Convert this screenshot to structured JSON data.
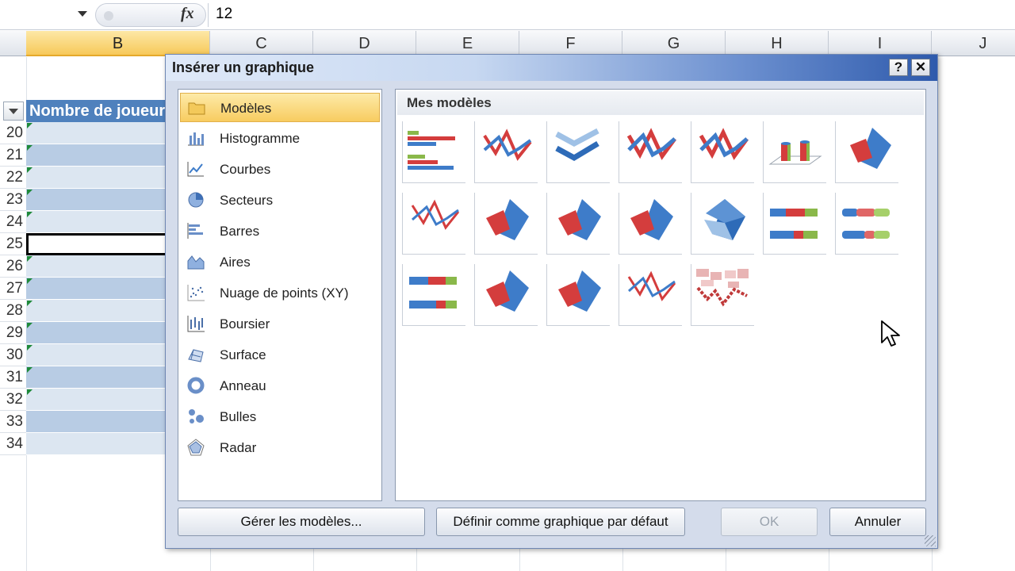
{
  "formula_bar": {
    "fx_label": "fx",
    "value": "12"
  },
  "columns": [
    "B",
    "C",
    "D",
    "E",
    "F",
    "G",
    "H",
    "I",
    "J"
  ],
  "sheet": {
    "table_header": "Nombre de joueurs",
    "rows": [
      "20",
      "21",
      "22",
      "23",
      "24",
      "25",
      "26",
      "27",
      "28",
      "29",
      "30",
      "31",
      "32",
      "33",
      "34"
    ]
  },
  "dialog": {
    "title": "Insérer un graphique",
    "help_label": "?",
    "close_label": "✕",
    "categories": [
      {
        "label": "Modèles",
        "icon": "folder-icon"
      },
      {
        "label": "Histogramme",
        "icon": "column-chart-icon"
      },
      {
        "label": "Courbes",
        "icon": "line-chart-icon"
      },
      {
        "label": "Secteurs",
        "icon": "pie-chart-icon"
      },
      {
        "label": "Barres",
        "icon": "bar-chart-icon"
      },
      {
        "label": "Aires",
        "icon": "area-chart-icon"
      },
      {
        "label": "Nuage de points (XY)",
        "icon": "scatter-chart-icon"
      },
      {
        "label": "Boursier",
        "icon": "stock-chart-icon"
      },
      {
        "label": "Surface",
        "icon": "surface-chart-icon"
      },
      {
        "label": "Anneau",
        "icon": "doughnut-chart-icon"
      },
      {
        "label": "Bulles",
        "icon": "bubble-chart-icon"
      },
      {
        "label": "Radar",
        "icon": "radar-chart-icon"
      }
    ],
    "selected_category": "Modèles",
    "templates_heading": "Mes modèles",
    "templates": [
      "bar",
      "line",
      "chevron",
      "line",
      "line",
      "cylinder",
      "pie",
      "line",
      "pie",
      "pie",
      "pie",
      "pie-3d",
      "stacked-bar",
      "stacked-bar",
      "stacked-bar",
      "pie",
      "pie",
      "line",
      "area-line"
    ],
    "buttons": {
      "manage": "Gérer les modèles...",
      "set_default": "Définir comme graphique par défaut",
      "ok": "OK",
      "cancel": "Annuler"
    }
  },
  "colors": {
    "red": "#d43d3d",
    "blue": "#3e7cc9",
    "green": "#8ab84a",
    "selection": "#f8cc60"
  }
}
